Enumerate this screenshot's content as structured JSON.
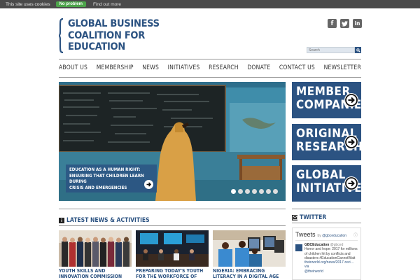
{
  "cookie": {
    "message": "This site uses cookies",
    "accept": "No problem",
    "more": "Find out more"
  },
  "logo": {
    "line1": "GLOBAL BUSINESS",
    "line2": "COALITION FOR",
    "line3": "EDUCATION"
  },
  "social": {
    "facebook": "f",
    "twitter": "t",
    "linkedin": "in"
  },
  "search": {
    "placeholder": "Search"
  },
  "nav": {
    "items": [
      "ABOUT US",
      "MEMBERSHIP",
      "NEWS",
      "INITIATIVES",
      "RESEARCH",
      "DONATE",
      "CONTACT US",
      "NEWSLETTER"
    ]
  },
  "hero": {
    "caption_line1": "EDUCATION AS A HUMAN RIGHT:",
    "caption_line2": "ENSURING THAT CHILDREN LEARN DURING",
    "caption_line3": "CRISIS AND EMERGENCIES",
    "slide_count": 7,
    "active_slide": 1
  },
  "side_buttons": [
    {
      "line1": "MEMBER",
      "line2": "COMPANIES"
    },
    {
      "line1": "ORIGINAL",
      "line2": "RESEARCH"
    },
    {
      "line1": "GLOBAL",
      "line2": "INITIATIVES"
    }
  ],
  "news": {
    "heading": "LATEST NEWS & ACTIVITIES",
    "items": [
      {
        "title": "YOUTH SKILLS AND INNOVATION COMMISSION DISCUSSES CHALLENGES"
      },
      {
        "title": "PREPARING TODAY'S YOUTH FOR THE WORKFORCE OF TOMORROW: THE"
      },
      {
        "title": "NIGERIA: EMBRACING LITERACY IN A DIGITAL AGE"
      }
    ]
  },
  "twitter": {
    "heading": "TWITTER",
    "widget_title": "Tweets",
    "widget_by": "by",
    "widget_handle": "@gbceducation",
    "tweet_name": "GBCEducation",
    "tweet_handle": "@gbced",
    "tweet_line1": "Horror and hope: 2017 for millions",
    "tweet_line2": "of children hit by conflicts and",
    "tweet_line3": "disasters #EducationCannotWait",
    "tweet_line4": "theirworld.org/news/2017-revi… via",
    "tweet_line5": "@theirworld"
  },
  "colors": {
    "brand_blue": "#2c5382",
    "cookie_bar": "#4a4a4a",
    "accept_green": "#4ca44a"
  }
}
